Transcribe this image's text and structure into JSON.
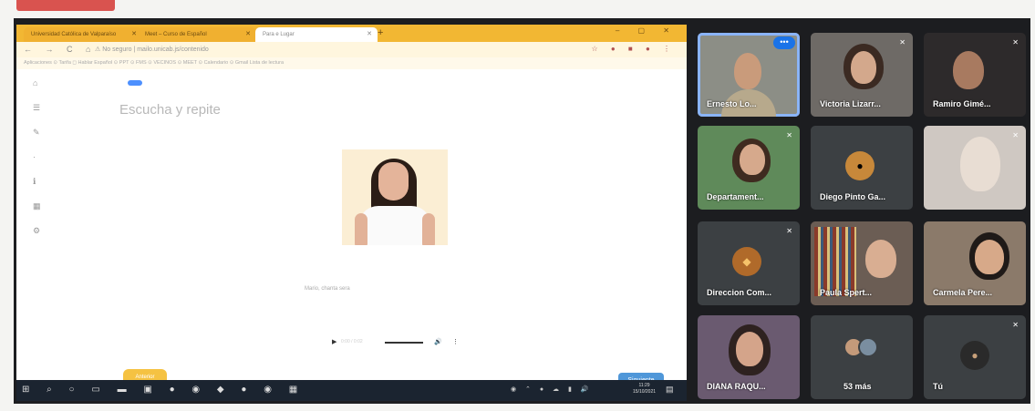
{
  "browser": {
    "tabs": [
      {
        "label": "Universidad Católica de Valparaíso"
      },
      {
        "label": "Meet – Curso de Español"
      },
      {
        "label": "Para e Lugar"
      }
    ],
    "new_tab": "+",
    "window_controls": "– ▢ ✕",
    "url": "⚠ No seguro | mailo.unicab.js/contenido",
    "bookmarks": "Aplicaciones  ⊙ Tarifa  ◻ Hablar Español  ⊙ PPT  ⊙ FMS  ⊙ VECINOS  ⊙ MEET  ⊙ Calendario  ⊙ Gmail  Lista de lectura"
  },
  "lesson": {
    "heading": "Escucha y repite",
    "caption": "Mario, chanta sera",
    "player_time": "0:00 / 0:02",
    "back_label": "Anterior",
    "next_label": "Siguiente"
  },
  "taskbar": {
    "clock_time": "11:29",
    "clock_date": "15/10/2021"
  },
  "participants": [
    {
      "name": "Ernesto Lo...",
      "active": true,
      "more": "•••"
    },
    {
      "name": "Victoria Lizarr..."
    },
    {
      "name": "Ramiro Gimé..."
    },
    {
      "name": "Departament..."
    },
    {
      "name": "Diego Pinto Ga..."
    },
    {
      "name": ""
    },
    {
      "name": "Direccion Com..."
    },
    {
      "name": "Paula Spert..."
    },
    {
      "name": "Carmela Pere..."
    },
    {
      "name": "DIANA RAQU..."
    },
    {
      "name": "53 más"
    },
    {
      "name": "Tú"
    }
  ],
  "colors": {
    "browser_tabbar": "#f2b733",
    "meet_background": "#1c1d20",
    "tile_background": "#3c4043",
    "next_button": "#4f97d9",
    "back_button": "#f5c242",
    "active_speaker_outline": "#8ab4f8"
  }
}
